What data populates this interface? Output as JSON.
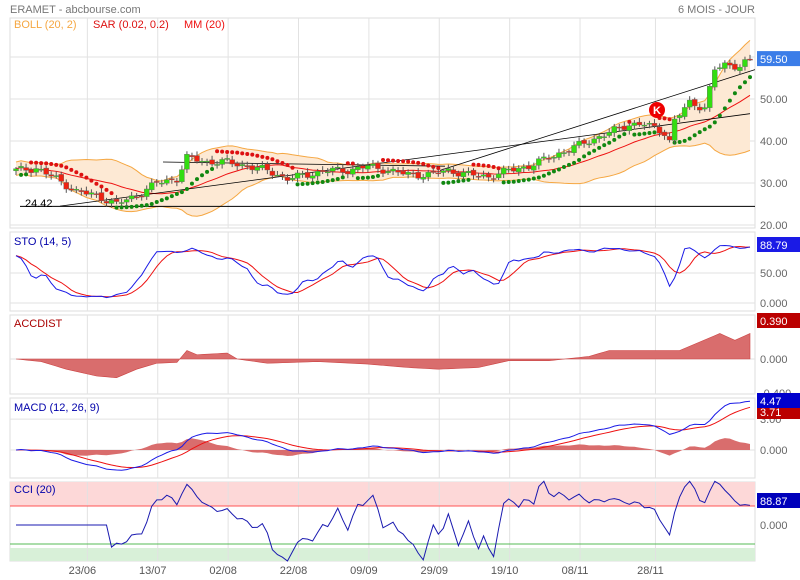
{
  "header": {
    "title": "ERAMET - abcbourse.com",
    "period": "6 MOIS - JOUR"
  },
  "colors": {
    "up": "#33dd11",
    "down": "#ee2211",
    "boll": "#f5a742",
    "bollFill": "#fde9d4",
    "sar_up": "#118811",
    "sar_down": "#dd1111",
    "mm": "#ee1111",
    "blue": "#1a1ae6",
    "red": "#ee1111",
    "area": "#d96d6d"
  },
  "chart_data": [
    {
      "type": "candlestick",
      "title": "ERAMET",
      "legend": [
        "BOLL (20, 2)",
        "SAR (0.02, 0.2)",
        "MM (20)"
      ],
      "ylim": [
        20,
        62
      ],
      "yticks": [
        "60.00",
        "50.00",
        "40.00",
        "30.00",
        "20.00"
      ],
      "ytick_values": [
        60,
        50,
        40,
        30,
        20
      ],
      "last_value": "59.50",
      "support_label": "24.42",
      "support_value": 24.42,
      "close_anchors": [
        [
          0,
          33
        ],
        [
          4,
          33.5
        ],
        [
          8,
          31
        ],
        [
          12,
          28
        ],
        [
          16,
          27
        ],
        [
          20,
          25
        ],
        [
          24,
          27
        ],
        [
          28,
          30
        ],
        [
          32,
          31
        ],
        [
          34,
          36
        ],
        [
          38,
          35
        ],
        [
          42,
          35
        ],
        [
          46,
          34
        ],
        [
          50,
          33
        ],
        [
          54,
          31
        ],
        [
          58,
          32
        ],
        [
          62,
          33
        ],
        [
          66,
          33
        ],
        [
          70,
          34
        ],
        [
          74,
          33
        ],
        [
          78,
          32
        ],
        [
          82,
          32
        ],
        [
          86,
          33
        ],
        [
          90,
          32
        ],
        [
          94,
          31.5
        ],
        [
          98,
          33
        ],
        [
          102,
          34
        ],
        [
          106,
          36
        ],
        [
          110,
          38
        ],
        [
          114,
          40
        ],
        [
          118,
          42
        ],
        [
          122,
          44
        ],
        [
          125,
          44
        ],
        [
          127,
          43
        ],
        [
          129,
          42
        ],
        [
          130,
          40
        ],
        [
          131,
          45
        ],
        [
          134,
          49
        ],
        [
          137,
          48
        ],
        [
          139,
          57
        ],
        [
          141,
          58
        ],
        [
          144,
          58
        ],
        [
          146,
          59.5
        ]
      ]
    },
    {
      "type": "line",
      "title": "STO (14, 5)",
      "last_value": "88.79",
      "yticks": [
        "50.00",
        "0.000"
      ],
      "ytick_values": [
        50,
        0
      ],
      "ylim": [
        -5,
        100
      ]
    },
    {
      "type": "area",
      "title": "ACCDIST",
      "last_value": "0.390",
      "yticks": [
        "0.000",
        "-0.400"
      ],
      "ytick_values": [
        0,
        -0.4
      ],
      "anchors": [
        [
          0,
          0
        ],
        [
          5,
          -0.03
        ],
        [
          10,
          -0.12
        ],
        [
          16,
          -0.2
        ],
        [
          20,
          -0.22
        ],
        [
          24,
          -0.12
        ],
        [
          28,
          -0.05
        ],
        [
          32,
          -0.04
        ],
        [
          34,
          0.1
        ],
        [
          36,
          0.05
        ],
        [
          42,
          0.07
        ],
        [
          44,
          0
        ],
        [
          50,
          -0.05
        ],
        [
          60,
          -0.03
        ],
        [
          70,
          -0.06
        ],
        [
          78,
          -0.1
        ],
        [
          84,
          -0.12
        ],
        [
          92,
          -0.1
        ],
        [
          98,
          -0.02
        ],
        [
          106,
          -0.02
        ],
        [
          114,
          0.03
        ],
        [
          118,
          0.1
        ],
        [
          126,
          0.1
        ],
        [
          132,
          0.1
        ],
        [
          136,
          0.2
        ],
        [
          140,
          0.3
        ],
        [
          143,
          0.22
        ],
        [
          146,
          0.3
        ]
      ]
    },
    {
      "type": "line",
      "title": "MACD (12, 26, 9)",
      "last_values": [
        "4.47",
        "3.71"
      ],
      "yticks": [
        "3.00",
        "0.000"
      ],
      "ytick_values": [
        3,
        0
      ]
    },
    {
      "type": "line",
      "title": "CCI (20)",
      "last_value": "88.87",
      "yticks": [
        "0.000"
      ],
      "ytick_values": [
        0
      ],
      "bands": [
        100,
        -100
      ]
    }
  ],
  "x_labels": [
    "23/06",
    "13/07",
    "02/08",
    "22/08",
    "09/09",
    "29/09",
    "19/10",
    "08/11",
    "28/11"
  ]
}
